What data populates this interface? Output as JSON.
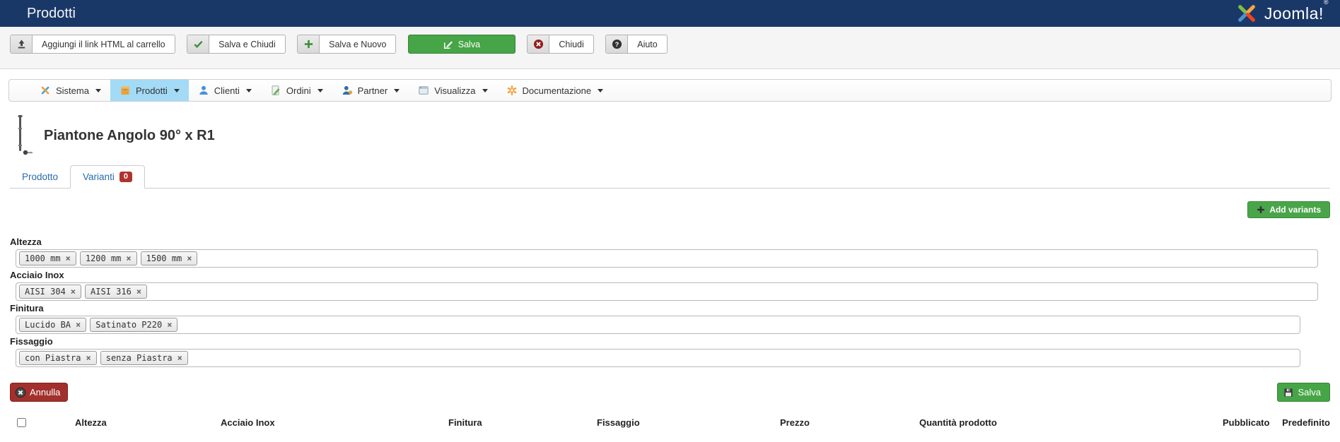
{
  "header": {
    "title": "Prodotti",
    "logo_text": "Joomla!",
    "logo_reg": "®"
  },
  "toolbar": {
    "buttons": [
      {
        "label": "Aggiungi il link HTML al carrello",
        "icon": "upload-icon"
      },
      {
        "label": "Salva e Chiudi",
        "icon": "check-icon"
      },
      {
        "label": "Salva e Nuovo",
        "icon": "plus-icon"
      },
      {
        "label": "Salva",
        "icon": "edit-icon",
        "style": "success"
      },
      {
        "label": "Chiudi",
        "icon": "cancel-icon"
      },
      {
        "label": "Aiuto",
        "icon": "help-icon"
      }
    ]
  },
  "menubar": {
    "items": [
      {
        "label": "Sistema",
        "icon": "tools-icon",
        "active": false
      },
      {
        "label": "Prodotti",
        "icon": "package-icon",
        "active": true
      },
      {
        "label": "Clienti",
        "icon": "user-icon",
        "active": false
      },
      {
        "label": "Ordini",
        "icon": "order-icon",
        "active": false
      },
      {
        "label": "Partner",
        "icon": "partner-icon",
        "active": false
      },
      {
        "label": "Visualizza",
        "icon": "monitor-icon",
        "active": false
      },
      {
        "label": "Documentazione",
        "icon": "docs-icon",
        "active": false
      }
    ]
  },
  "product": {
    "title": "Piantone Angolo 90° x R1"
  },
  "tabs": [
    {
      "label": "Prodotto",
      "active": false
    },
    {
      "label": "Varianti",
      "badge": "0",
      "active": true
    }
  ],
  "actions": {
    "add_variants": "Add variants",
    "annulla": "Annulla",
    "salva": "Salva"
  },
  "fields": [
    {
      "label": "Altezza",
      "tags": [
        "1000 mm",
        "1200 mm",
        "1500 mm"
      ]
    },
    {
      "label": "Acciaio Inox",
      "tags": [
        "AISI 304",
        "AISI 316"
      ]
    },
    {
      "label": "Finitura",
      "tags": [
        "Lucido BA",
        "Satinato P220"
      ]
    },
    {
      "label": "Fissaggio",
      "tags": [
        "con Piastra",
        "senza Piastra"
      ]
    }
  ],
  "variants_table": {
    "headers": [
      "Altezza",
      "Acciaio Inox",
      "Finitura",
      "Fissaggio",
      "Prezzo",
      "Quantità prodotto",
      "Pubblicato",
      "Predefinito"
    ]
  },
  "colors": {
    "header_navy": "#1a3867",
    "accent_green": "#46a546",
    "danger_red": "#a2302c",
    "active_menu_blue": "#a3daf6",
    "badge_red": "#b03330",
    "link_blue": "#2a6bac"
  }
}
